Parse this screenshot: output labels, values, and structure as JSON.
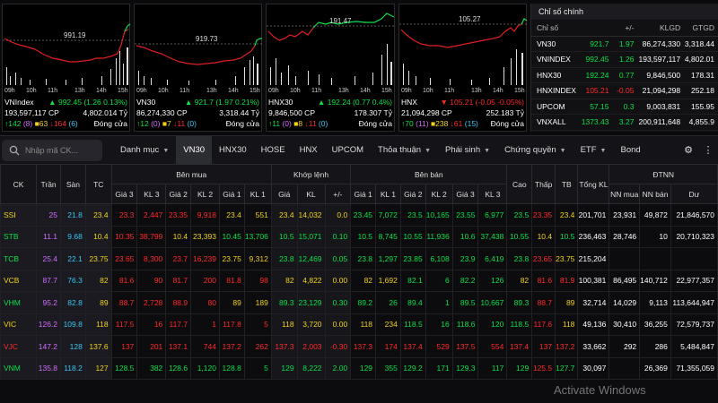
{
  "charts": [
    {
      "name": "VNIndex",
      "ref_label": "991.19",
      "arrow": "▲",
      "change": "992.45 (1.26 0.13%)",
      "volume": "193,597,117 CP",
      "value": "4,802.014 Tỷ",
      "up": "142",
      "ceil": "(8)",
      "ref": "63",
      "down": "164",
      "floor": "(6)",
      "status": "Đóng cửa",
      "times": [
        "09h",
        "10h",
        "11h",
        "13h",
        "14h",
        "15h"
      ]
    },
    {
      "name": "VN30",
      "ref_label": "919.73",
      "arrow": "▲",
      "change": "921.7 (1.97 0.21%)",
      "volume": "86,274,330 CP",
      "value": "3,318.44 Tỷ",
      "up": "12",
      "ceil": "(0)",
      "ref": "7",
      "down": "11",
      "floor": "(0)",
      "status": "Đóng cửa",
      "times": [
        "09h",
        "10h",
        "11h",
        "13h",
        "14h",
        "15h"
      ]
    },
    {
      "name": "HNX30",
      "ref_label": "191.47",
      "arrow": "▲",
      "change": "192.24 (0.77 0.4%)",
      "volume": "9,846,500 CP",
      "value": "178.307 Tỷ",
      "up": "11",
      "ceil": "(0)",
      "ref": "8",
      "down": "11",
      "floor": "(0)",
      "status": "Đóng cửa",
      "times": [
        "09h",
        "10h",
        "11h",
        "13h",
        "14h",
        "15h"
      ]
    },
    {
      "name": "HNX",
      "ref_label": "105.27",
      "arrow": "▼",
      "change": "105.21 (-0.05 -0.05%)",
      "volume": "21,094,298 CP",
      "value": "252.183 Tỷ",
      "up": "70",
      "ceil": "(11)",
      "ref": "238",
      "down": "61",
      "floor": "(15)",
      "status": "Đóng cửa",
      "times": [
        "09h",
        "10h",
        "11h",
        "13h",
        "14h",
        "15h"
      ]
    }
  ],
  "index_table": {
    "title": "Chỉ số chính",
    "headers": [
      "Chỉ số",
      "+/-",
      "KLGD",
      "GTGD"
    ],
    "rows": [
      [
        "VN30",
        "921.7",
        "1.97",
        "86,274,330",
        "3,318.44",
        "up"
      ],
      [
        "VNINDEX",
        "992.45",
        "1.26",
        "193,597,117",
        "4,802.01",
        "up"
      ],
      [
        "HNX30",
        "192.24",
        "0.77",
        "9,846,500",
        "178.31",
        "up"
      ],
      [
        "HNXINDEX",
        "105.21",
        "-0.05",
        "21,094,298",
        "252.18",
        "down"
      ],
      [
        "UPCOM",
        "57.15",
        "0.3",
        "9,003,831",
        "155.95",
        "up"
      ],
      [
        "VNXALL",
        "1373.43",
        "3.27",
        "200,911,648",
        "4,855.9",
        "up"
      ]
    ]
  },
  "toolbar": {
    "search_placeholder": "Nhập mã CK...",
    "tabs": [
      "Danh mục",
      "VN30",
      "HNX30",
      "HOSE",
      "HNX",
      "UPCOM",
      "Thỏa thuận",
      "Phái sinh",
      "Chứng quyền",
      "ETF",
      "Bond"
    ]
  },
  "board": {
    "groups": [
      "Bên mua",
      "Khớp lệnh",
      "Bên bán",
      "ĐTNN"
    ],
    "fixed_headers": [
      "CK",
      "Trần",
      "Sàn",
      "TC"
    ],
    "buy_headers": [
      "Giá 3",
      "KL 3",
      "Giá 2",
      "KL 2",
      "Giá 1",
      "KL 1"
    ],
    "match_headers": [
      "Giá",
      "KL",
      "+/-"
    ],
    "sell_headers": [
      "Giá 1",
      "KL 1",
      "Giá 2",
      "KL 2",
      "Giá 3",
      "KL 3"
    ],
    "extra_headers": [
      "Cao",
      "Thấp",
      "TB",
      "Tổng KL"
    ],
    "foreign_headers": [
      "NN mua",
      "NN bán",
      "Dư"
    ],
    "rows": [
      {
        "sym": "SSI",
        "c": "25",
        "f": "21.8",
        "r": "23.4",
        "b3": "23.3",
        "k3": "2,447",
        "b2": "23.35",
        "k2": "9,918",
        "b1": "23.4",
        "k1": "551",
        "p": "23.4",
        "kl": "14,032",
        "ch": "0.0",
        "s1": "23.45",
        "l1": "7,072",
        "s2": "23.5",
        "l2": "10,165",
        "s3": "23.55",
        "l3": "6,977",
        "hi": "23.5",
        "lo": "23.35",
        "av": "23.4",
        "tot": "201,701",
        "nb": "23,931",
        "ns": "49,872",
        "room": "21,846,570",
        "col": "ref"
      },
      {
        "sym": "STB",
        "c": "11.1",
        "f": "9.68",
        "r": "10.4",
        "b3": "10.35",
        "k3": "38,799",
        "b2": "10.4",
        "k2": "23,393",
        "b1": "10.45",
        "k1": "13,706",
        "p": "10.5",
        "kl": "15,071",
        "ch": "0.10",
        "s1": "10.5",
        "l1": "8,745",
        "s2": "10.55",
        "l2": "11,936",
        "s3": "10.6",
        "l3": "37,438",
        "hi": "10.55",
        "lo": "10.4",
        "av": "10.5",
        "tot": "236,463",
        "nb": "28,746",
        "ns": "10",
        "room": "20,710,323",
        "col": "up"
      },
      {
        "sym": "TCB",
        "c": "25.4",
        "f": "22.1",
        "r": "23.75",
        "b3": "23.65",
        "k3": "8,300",
        "b2": "23.7",
        "k2": "16,239",
        "b1": "23.75",
        "k1": "9,312",
        "p": "23.8",
        "kl": "12,469",
        "ch": "0.05",
        "s1": "23.8",
        "l1": "1,297",
        "s2": "23.85",
        "l2": "6,108",
        "s3": "23.9",
        "l3": "6,419",
        "hi": "23.8",
        "lo": "23.65",
        "av": "23.75",
        "tot": "215,204",
        "nb": "",
        "ns": "",
        "room": "",
        "col": "up"
      },
      {
        "sym": "VCB",
        "c": "87.7",
        "f": "76.3",
        "r": "82",
        "b3": "81.6",
        "k3": "90",
        "b2": "81.7",
        "k2": "200",
        "b1": "81.8",
        "k1": "98",
        "p": "82",
        "kl": "4,822",
        "ch": "0.00",
        "s1": "82",
        "l1": "1,692",
        "s2": "82.1",
        "l2": "6",
        "s3": "82.2",
        "l3": "126",
        "hi": "82",
        "lo": "81.6",
        "av": "81.9",
        "tot": "100,381",
        "nb": "86,495",
        "ns": "140,712",
        "room": "22,977,357",
        "col": "ref"
      },
      {
        "sym": "VHM",
        "c": "95.2",
        "f": "82.8",
        "r": "89",
        "b3": "88.7",
        "k3": "2,728",
        "b2": "88.9",
        "k2": "80",
        "b1": "89",
        "k1": "189",
        "p": "89.3",
        "kl": "23,129",
        "ch": "0.30",
        "s1": "89.2",
        "l1": "26",
        "s2": "89.4",
        "l2": "1",
        "s3": "89.5",
        "l3": "10,667",
        "hi": "89.3",
        "lo": "88.7",
        "av": "89",
        "tot": "32,714",
        "nb": "14,029",
        "ns": "9,113",
        "room": "113,644,947",
        "col": "up"
      },
      {
        "sym": "VIC",
        "c": "126.2",
        "f": "109.8",
        "r": "118",
        "b3": "117.5",
        "k3": "16",
        "b2": "117.7",
        "k2": "1",
        "b1": "117.8",
        "k1": "5",
        "p": "118",
        "kl": "3,720",
        "ch": "0.00",
        "s1": "118",
        "l1": "234",
        "s2": "118.5",
        "l2": "16",
        "s3": "118.6",
        "l3": "120",
        "hi": "118.5",
        "lo": "117.6",
        "av": "118",
        "tot": "49,136",
        "nb": "30,410",
        "ns": "36,255",
        "room": "72,579,737",
        "col": "ref"
      },
      {
        "sym": "VJC",
        "c": "147.2",
        "f": "128",
        "r": "137.6",
        "b3": "137",
        "k3": "201",
        "b2": "137.1",
        "k2": "744",
        "b1": "137.2",
        "k1": "262",
        "p": "137.3",
        "kl": "2,003",
        "ch": "-0.30",
        "s1": "137.3",
        "l1": "174",
        "s2": "137.4",
        "l2": "529",
        "s3": "137.5",
        "l3": "554",
        "hi": "137.4",
        "lo": "137",
        "av": "137.2",
        "tot": "33,662",
        "nb": "292",
        "ns": "286",
        "room": "5,484,847",
        "col": "down"
      },
      {
        "sym": "VNM",
        "c": "135.8",
        "f": "118.2",
        "r": "127",
        "b3": "128.5",
        "k3": "382",
        "b2": "128.6",
        "k2": "1,120",
        "b1": "128.8",
        "k1": "5",
        "p": "129",
        "kl": "8,222",
        "ch": "2.00",
        "s1": "129",
        "l1": "355",
        "s2": "129.2",
        "l2": "171",
        "s3": "129.3",
        "l3": "117",
        "hi": "129",
        "lo": "125.5",
        "av": "127.7",
        "tot": "30,097",
        "nb": "",
        "ns": "26,369",
        "room": "71,355,059",
        "col": "up"
      }
    ]
  },
  "colors": {
    "up": "#0ce04a",
    "down": "#ff2a2a",
    "ref": "#f2d21a",
    "ceil": "#d36cff",
    "floor": "#3bc6f0"
  },
  "watermark": "Activate Windows"
}
